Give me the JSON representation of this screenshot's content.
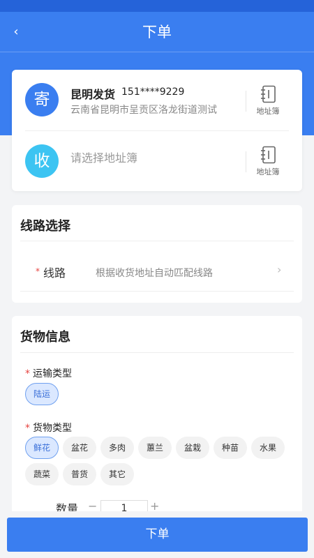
{
  "header": {
    "title": "下单",
    "back_icon": "‹"
  },
  "sender": {
    "badge": "寄",
    "name": "昆明发货",
    "phone": "151****9229",
    "address": "云南省昆明市呈贡区洛龙街道测试",
    "book_label": "地址簿"
  },
  "receiver": {
    "badge": "收",
    "placeholder": "请选择地址簿",
    "book_label": "地址簿"
  },
  "route": {
    "title": "线路选择",
    "required_mark": "*",
    "label": "线路",
    "hint": "根据收货地址自动匹配线路",
    "arrow": "›"
  },
  "goods": {
    "title": "货物信息",
    "transport_label": "运输类型",
    "transport_options": [
      "陆运"
    ],
    "cargo_label": "货物类型",
    "cargo_row1": [
      "鲜花",
      "盆花",
      "多肉",
      "蕙兰",
      "盆栽",
      "种苗",
      "水果"
    ],
    "cargo_row2": [
      "蔬菜",
      "普货",
      "其它"
    ],
    "qty_label": "数量",
    "qty_minus": "−",
    "qty_value": "1",
    "qty_plus": "+"
  },
  "submit_label": "下单",
  "colors": {
    "primary": "#3a7ef0",
    "status": "#2563d9",
    "receiver_badge": "#3cc4f2",
    "required": "#e64340"
  }
}
